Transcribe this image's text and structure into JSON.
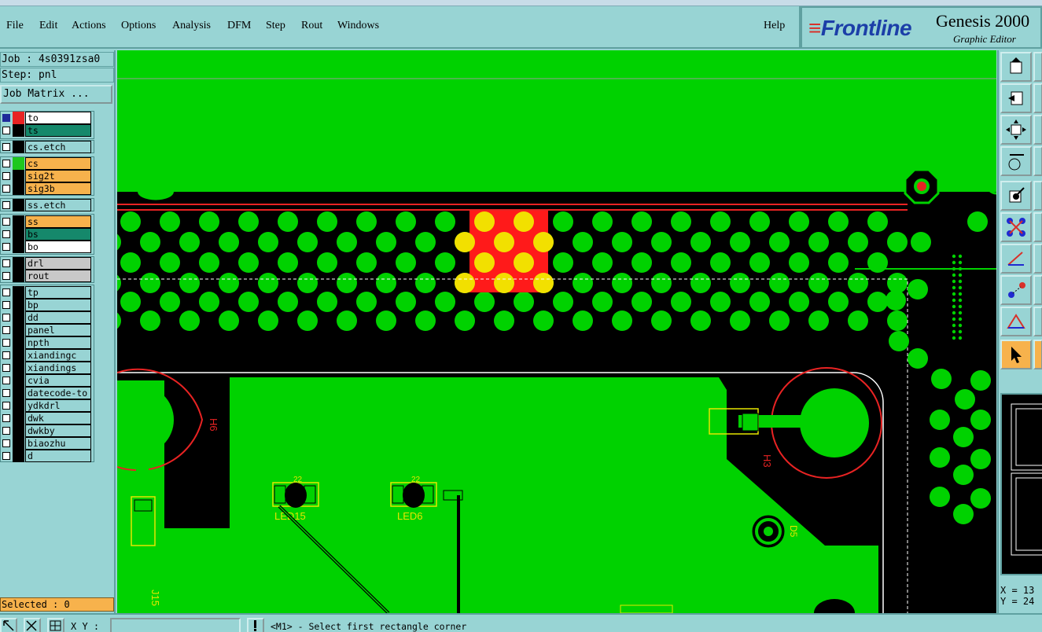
{
  "menu": {
    "items": [
      "File",
      "Edit",
      "Actions",
      "Options",
      "Analysis",
      "DFM",
      "Step",
      "Rout",
      "Windows"
    ],
    "help": "Help"
  },
  "brand": {
    "logo": "Frontline",
    "title": "Genesis 2000",
    "subtitle": "Graphic Editor"
  },
  "job": {
    "job_line": "Job : 4s0391zsa0",
    "step_line": "Step: pnl",
    "matrix_button": "Job Matrix ..."
  },
  "layers": [
    {
      "name": "to",
      "color": "#ffffff",
      "swatch": "#e82323",
      "checked": true
    },
    {
      "name": "ts",
      "color": "#15886b",
      "swatch": "#000000",
      "checked": false
    },
    {
      "name": "cs.etch",
      "color": "#98d4d4",
      "swatch": "#000000",
      "checked": false
    },
    {
      "name": "cs",
      "color": "#f7b24c",
      "swatch": "#1ec81e",
      "checked": false
    },
    {
      "name": "sig2t",
      "color": "#f7b24c",
      "swatch": "#000000",
      "checked": false
    },
    {
      "name": "sig3b",
      "color": "#f7b24c",
      "swatch": "#000000",
      "checked": false
    },
    {
      "name": "ss.etch",
      "color": "#98d4d4",
      "swatch": "#000000",
      "checked": false
    },
    {
      "name": "ss",
      "color": "#f7b24c",
      "swatch": "#000000",
      "checked": false
    },
    {
      "name": "bs",
      "color": "#15886b",
      "swatch": "#000000",
      "checked": false
    },
    {
      "name": "bo",
      "color": "#ffffff",
      "swatch": "#000000",
      "checked": false
    },
    {
      "name": "drl",
      "color": "#c8c8c8",
      "swatch": "#000000",
      "checked": false
    },
    {
      "name": "rout",
      "color": "#c8c8c8",
      "swatch": "#000000",
      "checked": false
    },
    {
      "name": "tp",
      "color": "#98d4d4",
      "swatch": "#000000",
      "checked": false
    },
    {
      "name": "bp",
      "color": "#98d4d4",
      "swatch": "#000000",
      "checked": false
    },
    {
      "name": "dd",
      "color": "#98d4d4",
      "swatch": "#000000",
      "checked": false
    },
    {
      "name": "panel",
      "color": "#98d4d4",
      "swatch": "#000000",
      "checked": false
    },
    {
      "name": "npth",
      "color": "#98d4d4",
      "swatch": "#000000",
      "checked": false
    },
    {
      "name": "xiandingc",
      "color": "#98d4d4",
      "swatch": "#000000",
      "checked": false
    },
    {
      "name": "xiandings",
      "color": "#98d4d4",
      "swatch": "#000000",
      "checked": false
    },
    {
      "name": "cvia",
      "color": "#98d4d4",
      "swatch": "#000000",
      "checked": false
    },
    {
      "name": "datecode-to",
      "color": "#98d4d4",
      "swatch": "#000000",
      "checked": false
    },
    {
      "name": "ydkdrl",
      "color": "#98d4d4",
      "swatch": "#000000",
      "checked": false
    },
    {
      "name": "dwk",
      "color": "#98d4d4",
      "swatch": "#000000",
      "checked": false
    },
    {
      "name": "dwkby",
      "color": "#98d4d4",
      "swatch": "#000000",
      "checked": false
    },
    {
      "name": "biaozhu",
      "color": "#98d4d4",
      "swatch": "#000000",
      "checked": false
    },
    {
      "name": "d",
      "color": "#98d4d4",
      "swatch": "#000000",
      "checked": false
    }
  ],
  "selected": "Selected : 0",
  "canvas": {
    "labels": {
      "h6": "H6",
      "h3": "H3",
      "led15": "LED15",
      "led6": "LED6",
      "j15": "J15",
      "d5": "D5",
      "tick": "22"
    },
    "colors": {
      "copper": "#00d200",
      "highlight": "#ff1a1a",
      "pad_highlight": "#f2e000",
      "outline": "#ffffff",
      "silk": "#e6e600",
      "trace": "#e82323"
    }
  },
  "coords": {
    "x": "X = 13",
    "y": "Y = 24"
  },
  "status": {
    "xy_label": "X Y :",
    "xy_value": "",
    "prompt": "<M1> - Select first rectangle corner"
  }
}
